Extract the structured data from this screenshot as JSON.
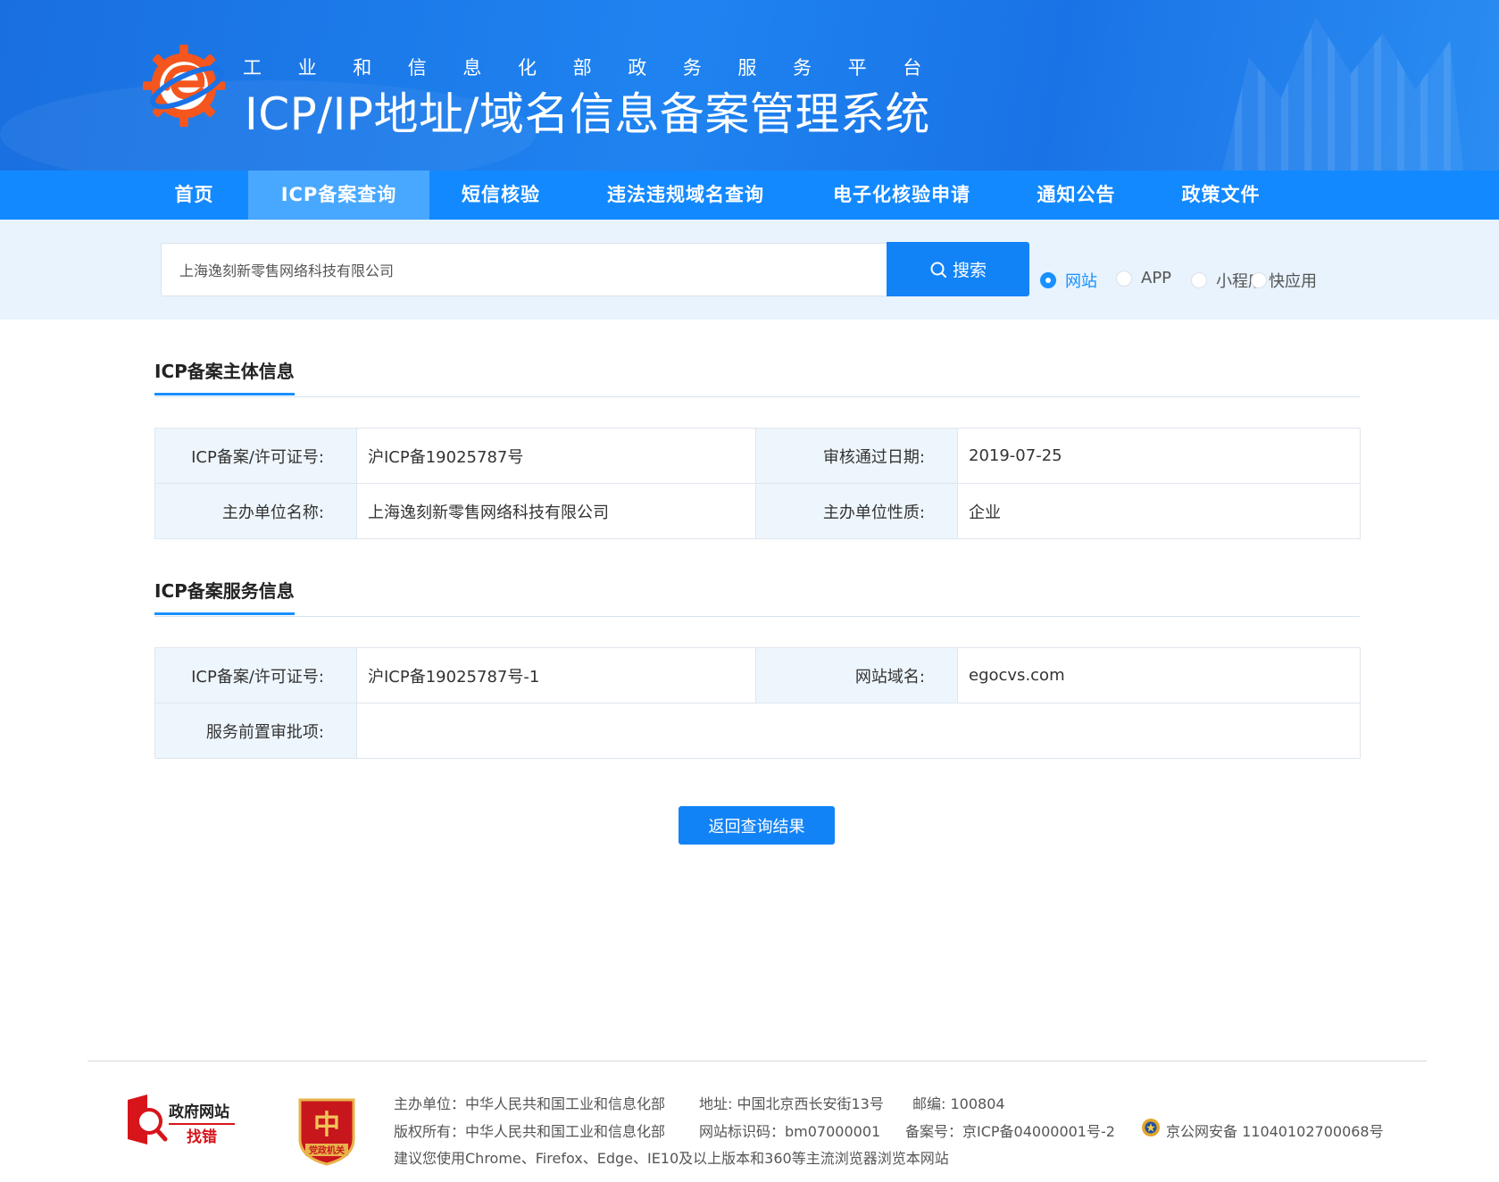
{
  "header": {
    "subtitle": "工业和信息化部政务服务平台",
    "title": "ICP/IP地址/域名信息备案管理系统",
    "logo_icon": "gear-e-logo-icon"
  },
  "nav": {
    "items": [
      {
        "label": "首页"
      },
      {
        "label": "ICP备案查询",
        "active": true
      },
      {
        "label": "短信核验"
      },
      {
        "label": "违法违规域名查询"
      },
      {
        "label": "电子化核验申请"
      },
      {
        "label": "通知公告"
      },
      {
        "label": "政策文件"
      }
    ]
  },
  "search": {
    "value": "上海逸刻新零售网络科技有限公司",
    "button_label": "搜索",
    "types": [
      {
        "label": "网站",
        "checked": true
      },
      {
        "label": "APP",
        "checked": false
      },
      {
        "label": "小程序",
        "checked": false
      },
      {
        "label": "快应用",
        "checked": false
      }
    ]
  },
  "subject": {
    "title": "ICP备案主体信息",
    "license_label": "ICP备案/许可证号:",
    "license_value": "沪ICP备19025787号",
    "approve_date_label": "审核通过日期:",
    "approve_date_value": "2019-07-25",
    "org_name_label": "主办单位名称:",
    "org_name_value": "上海逸刻新零售网络科技有限公司",
    "org_type_label": "主办单位性质:",
    "org_type_value": "企业"
  },
  "service": {
    "title": "ICP备案服务信息",
    "license_label": "ICP备案/许可证号:",
    "license_value": "沪ICP备19025787号-1",
    "domain_label": "网站域名:",
    "domain_value": "egocvs.com",
    "pre_approval_label": "服务前置审批项:",
    "pre_approval_value": ""
  },
  "back_button": "返回查询结果",
  "footer": {
    "badge1_line1": "政府网站",
    "badge1_line2": "找错",
    "badge2_text": "党政机关",
    "host": "主办单位：中华人民共和国工业和信息化部",
    "address": "地址: 中国北京西长安街13号",
    "postcode": "邮编: 100804",
    "copyright": "版权所有：中华人民共和国工业和信息化部",
    "site_code": "网站标识码：bm07000001",
    "icp": "备案号：京ICP备04000001号-2",
    "police": "京公网安备 11040102700068号",
    "browser_tip": "建议您使用Chrome、Firefox、Edge、IE10及以上版本和360等主流浏览器浏览本网站",
    "accent": "#1283f7"
  }
}
